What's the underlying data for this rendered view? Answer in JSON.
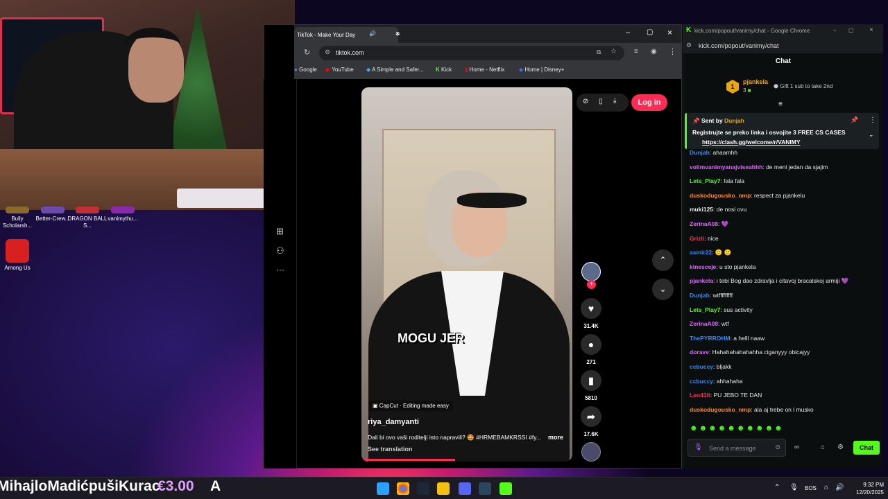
{
  "desktop": {
    "icons": [
      {
        "label": "Bully Scholarsh..."
      },
      {
        "label": "Better-Crew..."
      },
      {
        "label": "DRAGON BALL S..."
      },
      {
        "label": "vanimythu..."
      },
      {
        "label": "Among Us"
      }
    ]
  },
  "browser": {
    "tab_title": "TikTok - Make Your Day",
    "url": "tiktok.com",
    "bookmarks": [
      "Google",
      "YouTube",
      "A Simple and Safer...",
      "Kick",
      "Home - Netflix",
      "Home | Disney+"
    ]
  },
  "tiktok": {
    "login_label": "Log in",
    "caption_overlay": "MOGU JER",
    "capcut_label": "CapCut · Editing made easy",
    "username": "riya_damyanti",
    "description": "Dali bi ovo vaši roditelji isto napravili? 🤩 #HRMEBAMKRSSI #fy...",
    "more_label": "more",
    "see_translation": "See translation",
    "likes": "31.4K",
    "comments": "271",
    "saves": "5810",
    "shares": "17.6K"
  },
  "chat_window": {
    "title": "kick.com/popout/vanimy/chat - Google Chrome",
    "url": "kick.com/popout/vanimy/chat",
    "header": "Chat",
    "leader": {
      "rank": "1",
      "name": "pjankela",
      "count": "3",
      "gift_text": "Gift 1 sub to take 2nd"
    },
    "pinned": {
      "sent_by_label": "Sent by",
      "sender": "Dunjah",
      "text": "Registrujte se preko linka i osvojite 3 FREE CS CASES",
      "link": "https://clash.gg/welcome/r/VANIMY"
    },
    "messages": [
      {
        "user": "Dunjah",
        "text": ": ahaamhh",
        "color": "#2d8cf0"
      },
      {
        "user": "volimvanimyanajviseahhh",
        "text": ": de meni jedan da sjajim",
        "color": "#e066ff"
      },
      {
        "user": "Lets_Play7",
        "text": ": fala fala",
        "color": "#53fc18"
      },
      {
        "user": "duskodugousko_nmp",
        "text": ": respect za pjankelu",
        "color": "#ff8c1a"
      },
      {
        "user": "muki125",
        "text": ": de nosi ovu",
        "color": "#e8e8e8"
      },
      {
        "user": "ZerinaA08",
        "text": ": 💜",
        "color": "#e066ff"
      },
      {
        "user": "Grizli",
        "text": ": nice",
        "color": "#ff2d55"
      },
      {
        "user": "asmir22",
        "text": ": 🙂 🙂",
        "color": "#2d8cf0"
      },
      {
        "user": "kinesceje",
        "text": ": u sto pjankela",
        "color": "#e066ff"
      },
      {
        "user": "pjankela",
        "text": ": i tebi Bog dao zdravlja i citavoj bracalskoj armiji 💜",
        "color": "#e066ff"
      },
      {
        "user": "Dunjah",
        "text": ": wtfffffffff",
        "color": "#2d8cf0"
      },
      {
        "user": "Lets_Play7",
        "text": ": sus activity",
        "color": "#53fc18"
      },
      {
        "user": "ZerinaA08",
        "text": ": wtf",
        "color": "#e066ff"
      },
      {
        "user": "ThePYRROHM",
        "text": ": a helll naaw",
        "color": "#2d8cf0"
      },
      {
        "user": "doravv",
        "text": ": Hahahahahahahha ciganyyy obicajyy",
        "color": "#e066ff"
      },
      {
        "user": "ccbuccy",
        "text": ": bljakk",
        "color": "#2d8cf0"
      },
      {
        "user": "ccbuccy",
        "text": ": ahhahaha",
        "color": "#2d8cf0"
      },
      {
        "user": "Leo43lt",
        "text": ": PU JEBO TE DAN",
        "color": "#ff2d55"
      },
      {
        "user": "duskodugousko_nmp",
        "text": ": ala aj trebe on l musko",
        "color": "#ff8c1a"
      }
    ],
    "input_placeholder": "Send a message",
    "chat_button": "Chat"
  },
  "overlay": {
    "donor": "MihajloMadićpušiKurac",
    "amount": "€3.00",
    "letter": "A"
  },
  "taskbar": {
    "lang": "BOS",
    "time": "9:32 PM",
    "date": "12/20/2025"
  },
  "colors": {
    "kick_green": "#53fc18",
    "tiktok_red": "#fe2c55"
  }
}
